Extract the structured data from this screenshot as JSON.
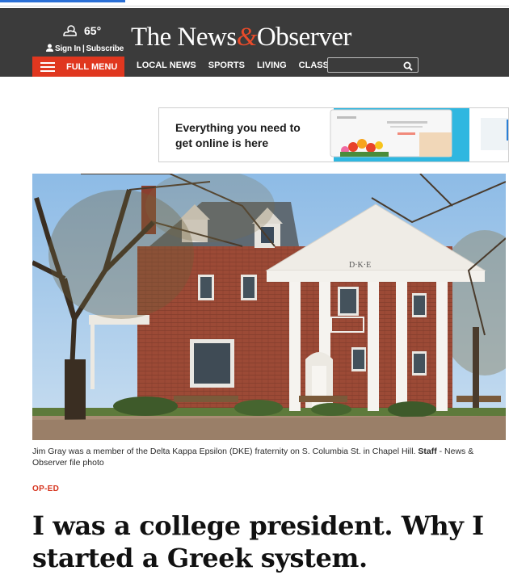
{
  "site": {
    "logo": {
      "part1": "The News",
      "amp": "&",
      "part2": "Observer"
    },
    "weather": {
      "temperature": "65°",
      "icon": "partly-cloudy-icon"
    },
    "account": {
      "sign_in": "Sign In",
      "separator": "|",
      "subscribe": "Subscribe"
    }
  },
  "nav": {
    "menu_label": "FULL MENU",
    "items": [
      "LOCAL NEWS",
      "SPORTS",
      "LIVING",
      "CLASSIFIEDS"
    ],
    "search_placeholder": ""
  },
  "ad": {
    "headline": "Everything you need to get online is here"
  },
  "article": {
    "photo_alt": "Delta Kappa Epsilon fraternity house, a red brick building with white columns",
    "building_sign": "D·K·E",
    "caption_text": "Jim Gray was a member of the Delta Kappa Epsilon (DKE) fraternity on S. Columbia St. in Chapel Hill.",
    "caption_credit": "Staff",
    "caption_source": " - News & Observer file photo",
    "section": "OP-ED",
    "headline": "I was a college president. Why I started a Greek system."
  },
  "colors": {
    "masthead": "#3b3b3b",
    "accent_red": "#e0371f",
    "link_blue": "#2a6fd6"
  }
}
